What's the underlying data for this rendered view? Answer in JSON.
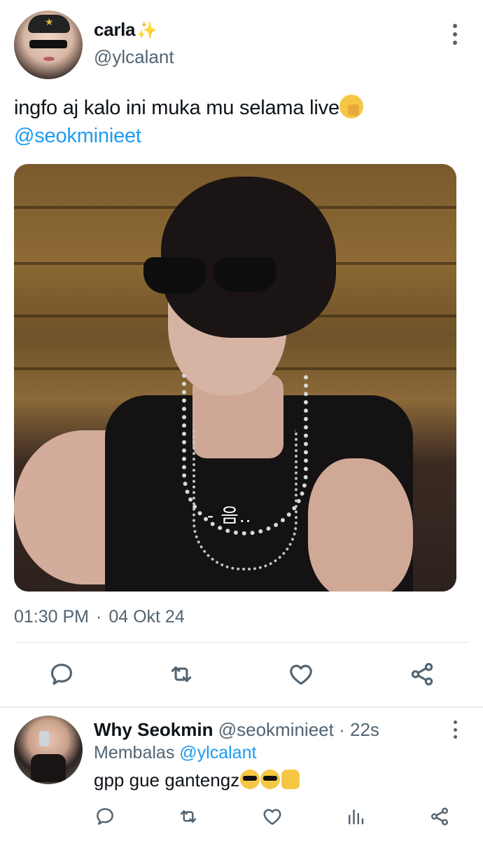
{
  "tweet": {
    "display_name": "carla",
    "name_emoji": "✨",
    "handle": "@ylcalant",
    "text": "ingfo aj kalo ini muka mu selama live",
    "mention": "@seokminieet",
    "photo_caption": "- 음..",
    "time": "01:30 PM",
    "separator": "·",
    "date": "04 Okt 24"
  },
  "actions": [
    "reply-icon",
    "retweet-icon",
    "like-icon",
    "share-icon"
  ],
  "reply": {
    "display_name": "Why Seokmin",
    "handle": "@seokminieet",
    "separator": "·",
    "age": "22s",
    "replying_label": "Membalas",
    "replying_to": "@ylcalant",
    "text": "gpp gue gantengz",
    "actions": [
      "reply-icon",
      "retweet-icon",
      "like-icon",
      "views-icon",
      "share-icon"
    ]
  },
  "colors": {
    "accent": "#1d9bf0",
    "secondary_text": "#536471",
    "primary_text": "#0f1419"
  }
}
